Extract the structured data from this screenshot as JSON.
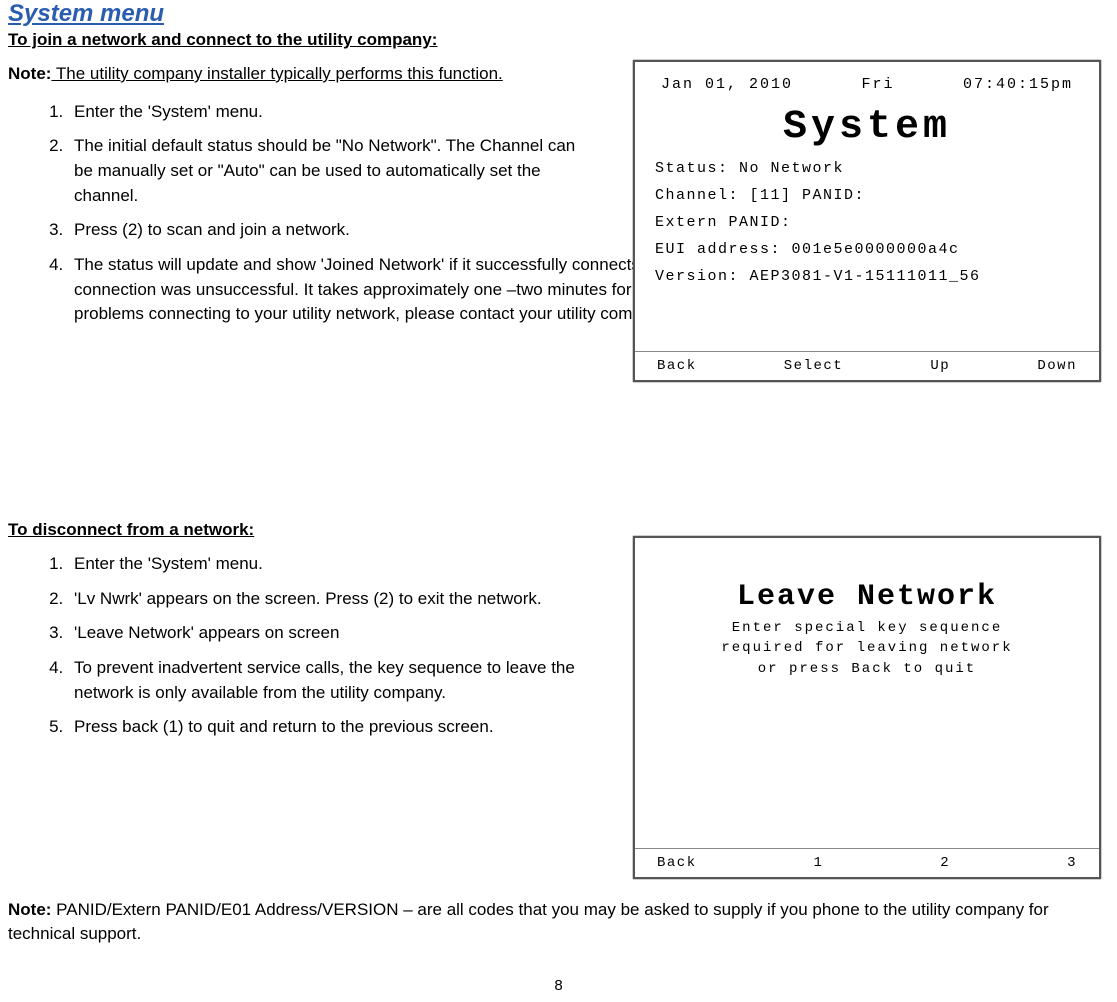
{
  "heading": "System menu",
  "section1": {
    "title": "To join a network and connect to the utility company:",
    "noteLabel": "Note:",
    "noteText": " The utility company installer typically performs this function.",
    "steps": [
      "Enter the 'System' menu.",
      "The initial default status should be \"No Network\".  The Channel can be manually set or \"Auto\" can be used to automatically set the channel.",
      "Press (2) to scan and join a network.",
      "The status will update and show 'Joined Network' if it successfully connects to your utility meter.  It will display 'Joined Failed' if your connection was unsuccessful.  It takes approximately one –two minutes for the connection process to complete. If you experience problems connecting to your utility network, please contact your utility company."
    ]
  },
  "section2": {
    "title": "To disconnect from a network:",
    "steps": [
      "Enter the 'System' menu.",
      "'Lv Nwrk' appears on the screen.  Press (2) to exit the network.",
      "'Leave Network' appears on screen",
      "To prevent inadvertent service calls, the key sequence to leave the network is only available from the utility company.",
      "Press back (1) to quit and return to the previous screen."
    ]
  },
  "note2Label": "Note:",
  "note2Text": " PANID/Extern PANID/E01 Address/VERSION – are all codes that you may be asked to supply if you phone to the utility company for technical support.",
  "pageNumber": "8",
  "screenSystem": {
    "date": "Jan 01, 2010",
    "day": "Fri",
    "time": "07:40:15pm",
    "title": "System",
    "status": "Status:   No Network",
    "channel": "Channel:  [11]       PANID:",
    "extern": "Extern PANID:",
    "eui": "EUI  address:  001e5e0000000a4c",
    "version": "Version:   AEP3081-V1-15111011_56",
    "btn1": "Back",
    "btn2": "Select",
    "btn3": "Up",
    "btn4": "Down"
  },
  "screenLeave": {
    "title": "Leave Network",
    "line1": "Enter special key sequence",
    "line2": "required for leaving network",
    "line3": "or press Back to quit",
    "btn1": "Back",
    "btn2": "1",
    "btn3": "2",
    "btn4": "3"
  }
}
